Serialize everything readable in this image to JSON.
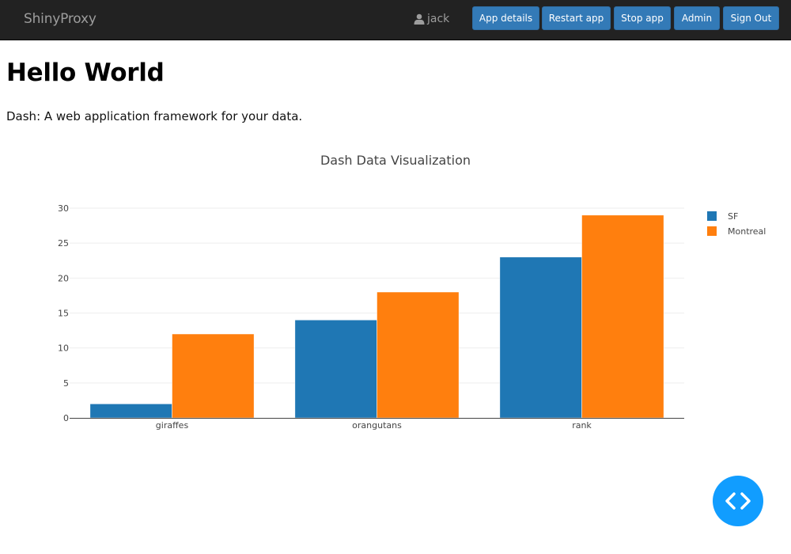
{
  "navbar": {
    "brand": "ShinyProxy",
    "user_icon": "user-icon",
    "username": "jack",
    "buttons": [
      "App details",
      "Restart app",
      "Stop app",
      "Admin",
      "Sign Out"
    ]
  },
  "page": {
    "title": "Hello World",
    "subtitle": "Dash: A web application framework for your data."
  },
  "fab": {
    "icon": "code-icon"
  },
  "colors": {
    "navbar_bg": "#222222",
    "button": "#337ab7",
    "sf": "#1f77b4",
    "montreal": "#ff7f0e",
    "fab": "#119dff"
  },
  "chart_data": {
    "type": "bar",
    "title": "Dash Data Visualization",
    "categories": [
      "giraffes",
      "orangutans",
      "rank"
    ],
    "series": [
      {
        "name": "SF",
        "values": [
          2,
          14,
          23
        ],
        "color": "#1f77b4"
      },
      {
        "name": "Montreal",
        "values": [
          12,
          18,
          29
        ],
        "color": "#ff7f0e"
      }
    ],
    "xlabel": "",
    "ylabel": "",
    "ylim": [
      0,
      30
    ],
    "yticks": [
      0,
      5,
      10,
      15,
      20,
      25,
      30
    ],
    "grid": true,
    "legend": "top-right",
    "barmode": "group"
  }
}
